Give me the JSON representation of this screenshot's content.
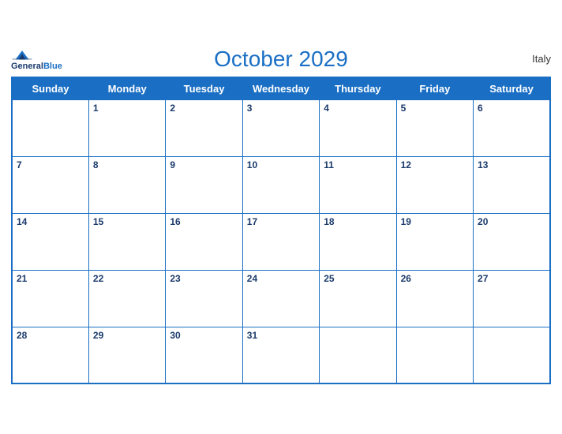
{
  "header": {
    "logo_general": "General",
    "logo_blue": "Blue",
    "title": "October 2029",
    "country": "Italy"
  },
  "weekdays": [
    "Sunday",
    "Monday",
    "Tuesday",
    "Wednesday",
    "Thursday",
    "Friday",
    "Saturday"
  ],
  "weeks": [
    [
      null,
      1,
      2,
      3,
      4,
      5,
      6
    ],
    [
      7,
      8,
      9,
      10,
      11,
      12,
      13
    ],
    [
      14,
      15,
      16,
      17,
      18,
      19,
      20
    ],
    [
      21,
      22,
      23,
      24,
      25,
      26,
      27
    ],
    [
      28,
      29,
      30,
      31,
      null,
      null,
      null
    ]
  ]
}
